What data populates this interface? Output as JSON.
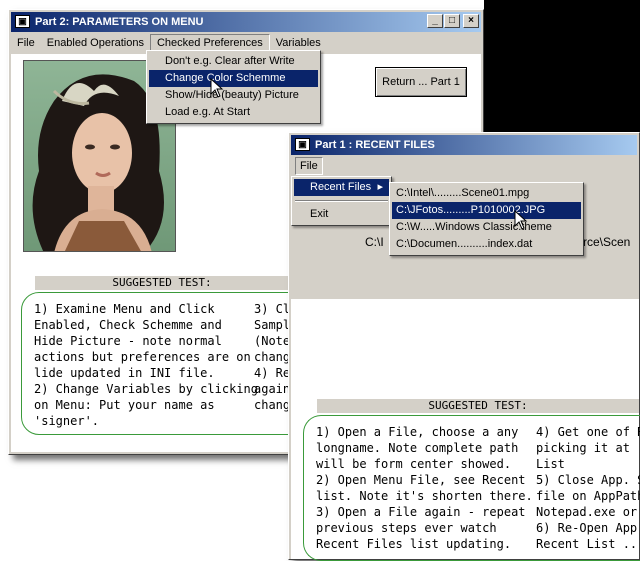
{
  "window2": {
    "title": "Part 2: PARAMETERS ON MENU",
    "menu": [
      "File",
      "Enabled Operations",
      "Checked Preferences",
      "Variables"
    ],
    "dropdown": [
      "Don't e.g. Clear after Write",
      "Change Color Schemme",
      "Show/Hide (beauty) Picture",
      "Load e.g. At Start"
    ],
    "return_button": "Return ... Part 1",
    "suggested_title": "SUGGESTED TEST:",
    "tests_col1": "1) Examine Menu and Click\nEnabled, Check Schemme and\nHide Picture - note normal\nactions but preferences are on\nlide updated in INI file.\n2) Change Variables by clicking\non Menu: Put your name as\n'signer'.",
    "tests_col2": "3) Clo\nSampl\n(Note\nchang\n4) Rel\nagain\nchang"
  },
  "window1": {
    "title": "Part 1 : RECENT FILES",
    "menu": [
      "File"
    ],
    "file_menu": [
      "Recent Files",
      "Exit"
    ],
    "recent_files": [
      "C:\\Intel\\.........Scene01.mpg",
      "C:\\JFotos.........P1010002.JPG",
      "C:\\W.....Windows Classic.theme",
      "C:\\Documen..........index.dat"
    ],
    "path_left": "C:\\I",
    "path_right": "rce\\Scen",
    "suggested_title": "SUGGESTED TEST:",
    "tests_col1": "1) Open a File, choose a any\nlongname. Note complete path\nwill be form center showed.\n2) Open Menu File, see Recent\nlist. Note it's shorten there.\n3) Open a File again - repeat\nprevious steps ever watch\nRecent Files list updating.",
    "tests_col2": "4) Get one of R\npicking it at List\n5) Close App. S\nfile on AppPath\nNotepad.exe or\n6) Re-Open App\nRecent List ... e"
  },
  "titlebar_buttons": [
    "_",
    "□",
    "×"
  ],
  "colors": {
    "title_active": "#0a246a",
    "title_gradient_end": "#a6caf0",
    "face": "#d4d0c8",
    "tests_border": "#3a9a3a",
    "selection": "#0a246a"
  }
}
